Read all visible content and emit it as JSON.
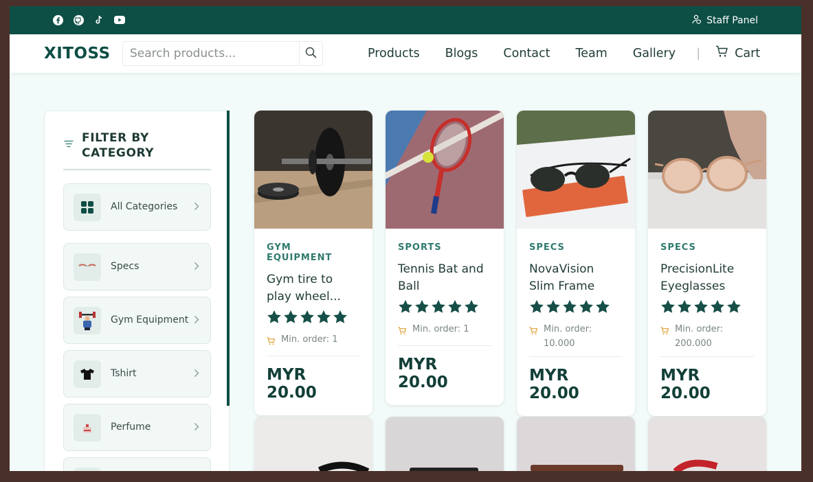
{
  "topbar": {
    "social_icons": [
      "facebook-icon",
      "github-icon",
      "tiktok-icon",
      "youtube-icon"
    ],
    "staff_panel_label": "Staff Panel"
  },
  "nav": {
    "logo": "XITOSS",
    "search_placeholder": "Search products...",
    "links": [
      "Products",
      "Blogs",
      "Contact",
      "Team",
      "Gallery"
    ],
    "separator": "|",
    "cart_label": "Cart"
  },
  "sidebar": {
    "title": "FILTER BY CATEGORY",
    "categories": [
      {
        "label": "All Categories",
        "icon": "grid-icon"
      },
      {
        "label": "Specs",
        "icon": "specs-thumb"
      },
      {
        "label": "Gym Equipment",
        "icon": "gym-thumb"
      },
      {
        "label": "Tshirt",
        "icon": "tshirt-thumb"
      },
      {
        "label": "Perfume",
        "icon": "perfume-thumb"
      }
    ]
  },
  "products": [
    {
      "category": "GYM EQUIPMENT",
      "name": "Gym tire to play wheel...",
      "rating": 5,
      "min_order": "Min. order: 1",
      "price": "MYR 20.00"
    },
    {
      "category": "SPORTS",
      "name": "Tennis Bat and Ball",
      "rating": 5,
      "min_order": "Min. order: 1",
      "price": "MYR 20.00"
    },
    {
      "category": "SPECS",
      "name": "NovaVision Slim Frame",
      "rating": 5,
      "min_order": "Min. order: 10.000",
      "price": "MYR 20.00"
    },
    {
      "category": "SPECS",
      "name": "PrecisionLite Eyeglasses",
      "rating": 5,
      "min_order": "Min. order: 200.000",
      "price": "MYR 20.00"
    }
  ],
  "colors": {
    "primary": "#0d4e45",
    "accent_text": "#2f7a6e",
    "star": "#164f47",
    "cart_orange": "#e0a032",
    "background": "#f2fbf9"
  }
}
